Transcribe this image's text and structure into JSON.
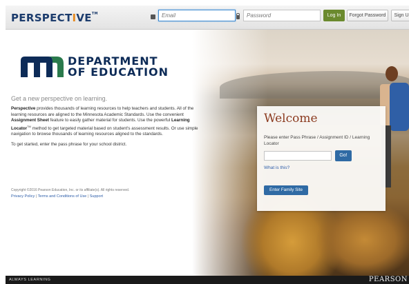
{
  "header": {
    "brand_main": "PERSPECT",
    "brand_accent": "I",
    "brand_tail": "VE",
    "brand_tm": "TM",
    "email_placeholder": "Email",
    "password_placeholder": "Password",
    "login_label": "Log In",
    "forgot_label": "Forgot Password",
    "signup_label": "Sign Up"
  },
  "logo": {
    "line1": "DEPARTMENT",
    "line2": "OF EDUCATION",
    "color": "#0d2b57"
  },
  "content": {
    "tagline": "Get a new perspective on learning.",
    "intro_bold1": "Perspective",
    "intro_part1": " provides thousands of learning resources to help teachers and students. All of the learning resources are aligned to the Minnesota Academic Standards. Use the convenient ",
    "intro_bold2": "Assignment Sheet",
    "intro_part2": " feature to easily gather material for students. Use the powerful ",
    "intro_bold3": "Learning Locator",
    "intro_tm": "TM",
    "intro_part3": " method to get targeted material based on student's assessment results. Or use simple navigation to browse thousands of learning resources aligned to the standards.",
    "get_started": "To get started, enter the pass phrase for your school district.",
    "copyright": "Copyright ©2016 Pearson Education, Inc. or its affiliate(s). All rights reserved.",
    "privacy_link": "Privacy Policy",
    "terms_link": "Terms and Conditions of Use",
    "support_link": "Support",
    "separator": "|"
  },
  "welcome": {
    "title": "Welcome",
    "prompt": "Please enter Pass Phrase / Assignment ID / Learning Locator",
    "go_label": "Go!",
    "what_link": "What is this?",
    "family_button": "Enter Family Site"
  },
  "footer": {
    "always_learning": "ALWAYS LEARNING",
    "pearson": "PEARSON"
  },
  "colors": {
    "brand_blue": "#1c3c6d",
    "brand_orange": "#e6891e",
    "login_green": "#6b8a2e",
    "action_blue": "#2f6aa4",
    "welcome_rust": "#8b3a1e"
  }
}
